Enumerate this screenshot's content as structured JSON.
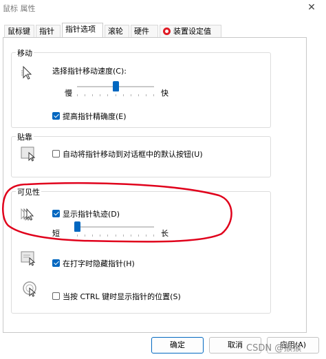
{
  "window": {
    "title": "鼠标 属性"
  },
  "tabs": [
    {
      "label": "鼠标键"
    },
    {
      "label": "指针"
    },
    {
      "label": "指针选项"
    },
    {
      "label": "滚轮"
    },
    {
      "label": "硬件"
    },
    {
      "label": "装置设定值"
    }
  ],
  "motion": {
    "legend": "移动",
    "speed_label": "选择指针移动速度(C):",
    "slow_label": "慢",
    "fast_label": "快",
    "speed_level": 0.5,
    "precision_label": "提高指针精确度(E)",
    "precision_checked": true
  },
  "snap": {
    "legend": "贴靠",
    "label": "自动将指针移动到对话框中的默认按钮(U)",
    "checked": false
  },
  "visibility": {
    "legend": "可见性",
    "trails_label": "显示指针轨迹(D)",
    "trails_checked": true,
    "short_label": "短",
    "long_label": "长",
    "trails_level": 0.0,
    "hide_label": "在打字时隐藏指针(H)",
    "hide_checked": true,
    "ctrl_label": "当按 CTRL 键时显示指针的位置(S)",
    "ctrl_checked": false
  },
  "buttons": {
    "ok": "确定",
    "cancel": "取消",
    "apply": "应用(A)"
  },
  "annotation": {
    "color": "#e0001b"
  },
  "watermark": "CSDN @猴猴"
}
